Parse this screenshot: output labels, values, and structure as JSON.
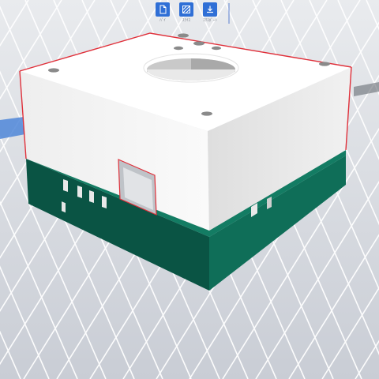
{
  "toolbar": {
    "items": [
      {
        "name": "new",
        "label": "ﾊﾞｲ",
        "icon": "page-icon"
      },
      {
        "name": "slice",
        "label": "ｽﾗｲｽ",
        "icon": "slice-icon"
      },
      {
        "name": "export",
        "label": "ｴｸｽﾎﾟｰﾄ",
        "icon": "download-icon"
      }
    ]
  },
  "colors": {
    "background": "#d9dce2",
    "grid_line": "#ffffff",
    "model_body": "#f4f4f4",
    "model_top": "#ffffff",
    "base_plate": "#0e6a56",
    "base_plate_dark": "#0a4f40",
    "selection_edge": "#e0303a",
    "accent_blue": "#2f6fd6"
  }
}
